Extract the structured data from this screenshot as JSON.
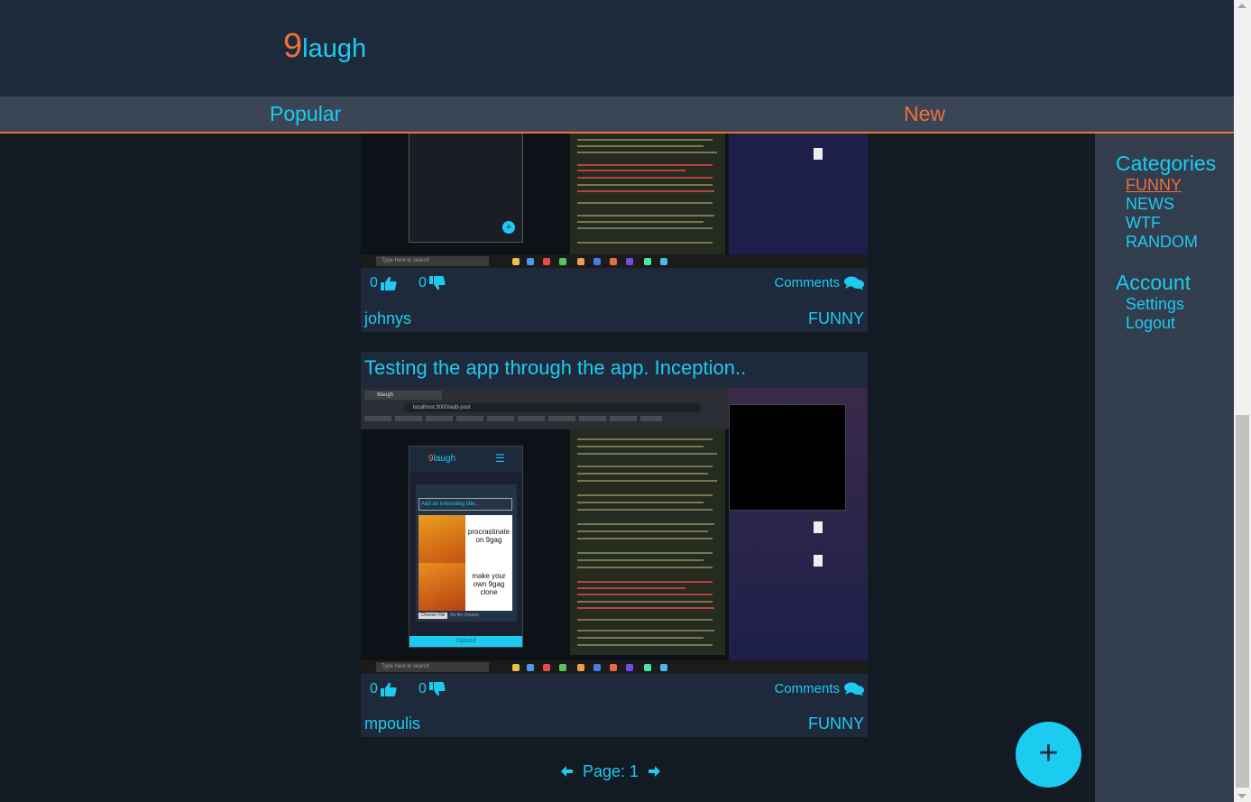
{
  "brand": {
    "nine": "9",
    "laugh": "laugh",
    "accent": "#f0703a",
    "primary": "#1ccbf0"
  },
  "tabs": {
    "popular": "Popular",
    "new": "New"
  },
  "sidebar": {
    "categories_title": "Categories",
    "categories": [
      "FUNNY",
      "NEWS",
      "WTF",
      "RANDOM"
    ],
    "active_category": "FUNNY",
    "account_title": "Account",
    "account": [
      "Settings",
      "Logout"
    ]
  },
  "posts": [
    {
      "title": "",
      "likes": "0",
      "dislikes": "0",
      "comments_label": "Comments",
      "author": "johnys",
      "category": "FUNNY"
    },
    {
      "title": "Testing the app through the app. Inception..",
      "likes": "0",
      "dislikes": "0",
      "comments_label": "Comments",
      "author": "mpoulis",
      "category": "FUNNY",
      "inner": {
        "tab": "9laugh",
        "url": "localhost:3000/add-post",
        "app_logo_nine": "9",
        "app_logo_laugh": "laugh",
        "title_placeholder": "Add an interesting title...",
        "meme_top": "procrastinate on 9gag",
        "meme_bottom": "make your own 9gag clone",
        "choose_file": "Choose File",
        "no_file": "No file chosen",
        "upload": "Upload",
        "taskbar_search": "Type here to search"
      }
    }
  ],
  "pager": {
    "label": "Page: 1"
  },
  "fab": {
    "label": "+"
  }
}
